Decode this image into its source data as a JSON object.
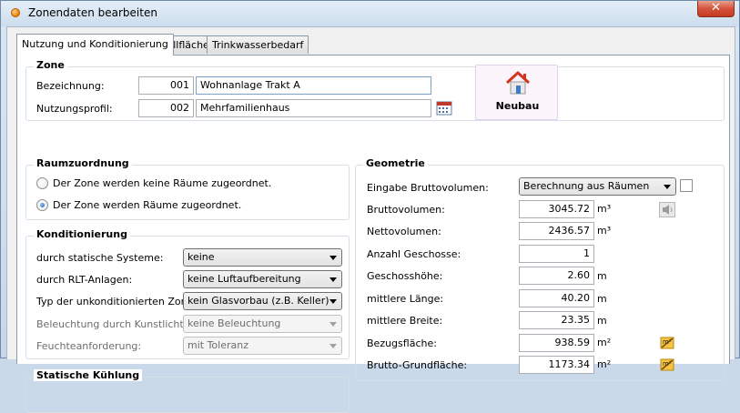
{
  "window": {
    "title": "Zonendaten bearbeiten",
    "close_symbol": "✕"
  },
  "tabs": [
    {
      "label": "Nutzung und Konditionierung",
      "active": true
    },
    {
      "label": "Hüllfläche",
      "active": false
    },
    {
      "label": "Trinkwasserbedarf",
      "active": false
    }
  ],
  "zone": {
    "title": "Zone",
    "bezeichnung_label": "Bezeichnung:",
    "bezeichnung_code": "001",
    "bezeichnung_value": "Wohnanlage Trakt A",
    "nutzungsprofil_label": "Nutzungsprofil:",
    "nutzungsprofil_code": "002",
    "nutzungsprofil_value": "Mehrfamilienhaus",
    "neubau_label": "Neubau"
  },
  "raumzuordnung": {
    "title": "Raumzuordnung",
    "option_none": "Der Zone werden keine Räume zugeordnet.",
    "option_some": "Der Zone werden Räume zugeordnet.",
    "selected": "option_some"
  },
  "konditionierung": {
    "title": "Konditionierung",
    "rows": [
      {
        "label": "durch statische Systeme:",
        "value": "keine",
        "disabled": false
      },
      {
        "label": "durch RLT-Anlagen:",
        "value": "keine Luftaufbereitung",
        "disabled": false
      },
      {
        "label": "Typ der unkonditionierten Zone:",
        "value": "kein Glasvorbau (z.B. Keller)",
        "disabled": false
      },
      {
        "label": "Beleuchtung durch Kunstlicht:",
        "value": "keine Beleuchtung",
        "disabled": true
      },
      {
        "label": "Feuchteanforderung:",
        "value": "mit Toleranz",
        "disabled": true
      }
    ]
  },
  "statische_kuehlung": {
    "title": "Statische Kühlung"
  },
  "geometrie": {
    "title": "Geometrie",
    "eingabe_label": "Eingabe Bruttovolumen:",
    "eingabe_value": "Berechnung aus Räumen",
    "rows": [
      {
        "label": "Bruttovolumen:",
        "value": "3045.72",
        "unit": "m³"
      },
      {
        "label": "Nettovolumen:",
        "value": "2436.57",
        "unit": "m³"
      },
      {
        "label": "Anzahl Geschosse:",
        "value": "1",
        "unit": ""
      },
      {
        "label": "Geschosshöhe:",
        "value": "2.60",
        "unit": "m"
      },
      {
        "label": "mittlere Länge:",
        "value": "40.20",
        "unit": "m"
      },
      {
        "label": "mittlere Breite:",
        "value": "23.35",
        "unit": "m"
      },
      {
        "label": "Bezugsfläche:",
        "value": "938.59",
        "unit": "m²"
      },
      {
        "label": "Brutto-Grundfläche:",
        "value": "1173.34",
        "unit": "m²"
      }
    ]
  }
}
